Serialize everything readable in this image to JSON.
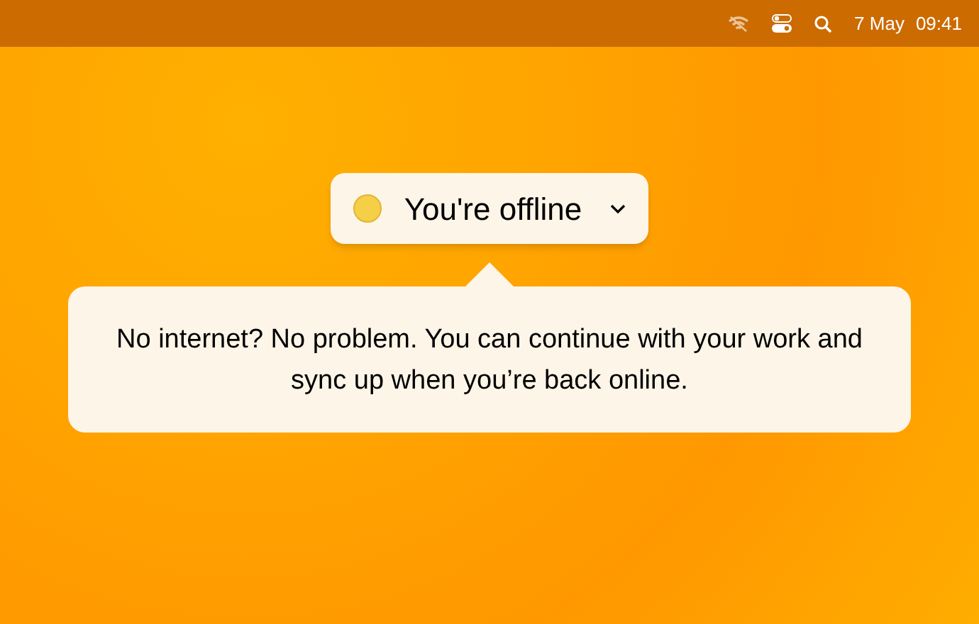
{
  "menu_bar": {
    "date": "7 May",
    "time": "09:41"
  },
  "status_pill": {
    "online": false,
    "label": "You're offline"
  },
  "popover": {
    "message": "No internet? No problem. You can continue with your work and sync up when you’re back online."
  }
}
